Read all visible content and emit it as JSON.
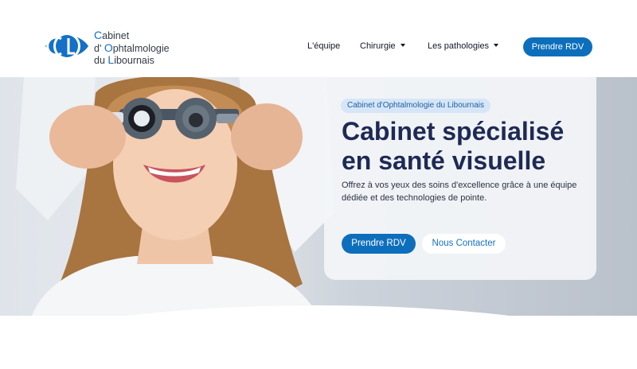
{
  "brand": {
    "line1_cap": "C",
    "line1_rest": "abinet",
    "line2_pre": "d'",
    "line2_cap": "O",
    "line2_rest": "phtalmologie",
    "line3_pre": "du",
    "line3_cap": "L",
    "line3_rest": "ibournais",
    "logo_icon": "eye-logo-icon",
    "accent": "#1570c6"
  },
  "nav": {
    "items": [
      {
        "label": "L'équipe"
      },
      {
        "label": "Chirurgie"
      },
      {
        "label": "Les pathologies"
      }
    ],
    "cta": "Prendre RDV"
  },
  "hero": {
    "badge": "Cabinet d'Ophtalmologie du Libournais",
    "title": "Cabinet spécialisé en santé visuelle",
    "subtitle": "Offrez à vos yeux des soins d'excellence grâce à une équipe dédiée et des technologies de pointe.",
    "primary_button": "Prendre RDV",
    "secondary_button": "Nous Contacter",
    "image_subject": "patient-eye-exam-photo"
  },
  "colors": {
    "primary": "#0d6fbc",
    "heading": "#1e2a55",
    "badge_bg": "#d6e6f8"
  }
}
